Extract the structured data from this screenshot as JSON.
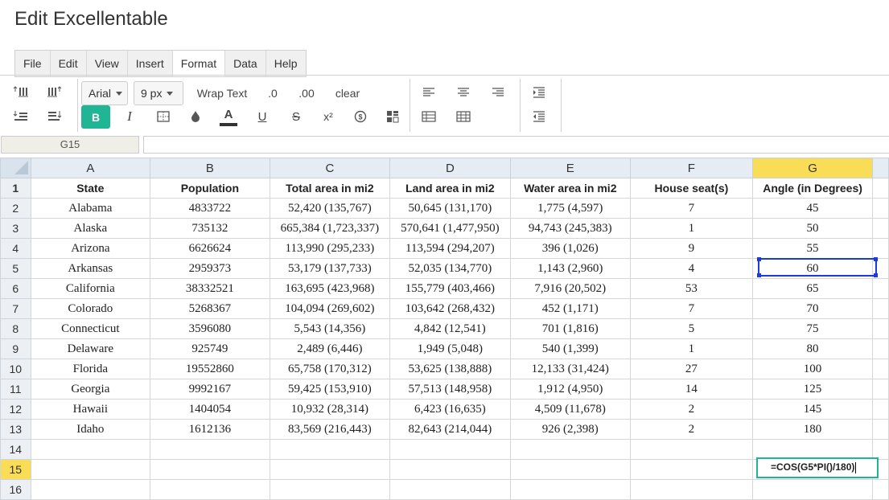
{
  "app": {
    "title": "Edit Excellentable"
  },
  "menu": [
    "File",
    "Edit",
    "View",
    "Insert",
    "Format",
    "Data",
    "Help"
  ],
  "menu_active": "Format",
  "toolbar": {
    "font_family": "Arial",
    "font_size": "9 px",
    "wrap_text": "Wrap Text",
    "dec_less": ".0",
    "dec_more": ".00",
    "clear": "clear",
    "bold": "B",
    "italic": "I",
    "font_color": "A",
    "underline": "U",
    "strike": "S",
    "superscript": "x²",
    "accent_color": "#1fb595"
  },
  "namebox": "G15",
  "formula_bar": "",
  "columns": [
    "A",
    "B",
    "C",
    "D",
    "E",
    "F",
    "G"
  ],
  "selected_column": "G",
  "selected_row": "15",
  "row_numbers": [
    "1",
    "2",
    "3",
    "4",
    "5",
    "6",
    "7",
    "8",
    "9",
    "10",
    "11",
    "12",
    "13",
    "14",
    "15",
    "16"
  ],
  "rows": [
    [
      "State",
      "Population",
      "Total area in mi2",
      "Land area in mi2",
      "Water area in mi2",
      "House seat(s)",
      "Angle (in Degrees)"
    ],
    [
      "Alabama",
      "4833722",
      "52,420 (135,767)",
      "50,645 (131,170)",
      "1,775 (4,597)",
      "7",
      "45"
    ],
    [
      "Alaska",
      "735132",
      "665,384 (1,723,337)",
      "570,641 (1,477,950)",
      "94,743 (245,383)",
      "1",
      "50"
    ],
    [
      "Arizona",
      "6626624",
      "113,990 (295,233)",
      "113,594 (294,207)",
      "396 (1,026)",
      "9",
      "55"
    ],
    [
      "Arkansas",
      "2959373",
      "53,179 (137,733)",
      "52,035 (134,770)",
      "1,143 (2,960)",
      "4",
      "60"
    ],
    [
      "California",
      "38332521",
      "163,695 (423,968)",
      "155,779 (403,466)",
      "7,916 (20,502)",
      "53",
      "65"
    ],
    [
      "Colorado",
      "5268367",
      "104,094 (269,602)",
      "103,642 (268,432)",
      "452 (1,171)",
      "7",
      "70"
    ],
    [
      "Connecticut",
      "3596080",
      "5,543 (14,356)",
      "4,842 (12,541)",
      "701 (1,816)",
      "5",
      "75"
    ],
    [
      "Delaware",
      "925749",
      "2,489 (6,446)",
      "1,949 (5,048)",
      "540 (1,399)",
      "1",
      "80"
    ],
    [
      "Florida",
      "19552860",
      "65,758 (170,312)",
      "53,625 (138,888)",
      "12,133 (31,424)",
      "27",
      "100"
    ],
    [
      "Georgia",
      "9992167",
      "59,425 (153,910)",
      "57,513 (148,958)",
      "1,912 (4,950)",
      "14",
      "125"
    ],
    [
      "Hawaii",
      "1404054",
      "10,932 (28,314)",
      "6,423 (16,635)",
      "4,509 (11,678)",
      "2",
      "145"
    ],
    [
      "Idaho",
      "1612136",
      "83,569 (216,443)",
      "82,643 (214,044)",
      "926 (2,398)",
      "2",
      "180"
    ],
    [
      "",
      "",
      "",
      "",
      "",
      "",
      ""
    ],
    [
      "",
      "",
      "",
      "",
      "",
      "",
      ""
    ],
    [
      "",
      "",
      "",
      "",
      "",
      "",
      ""
    ]
  ],
  "cell_editor": {
    "cell": "G15",
    "value": "=COS(G5*PI()/180)"
  },
  "selected_cell": "G5"
}
